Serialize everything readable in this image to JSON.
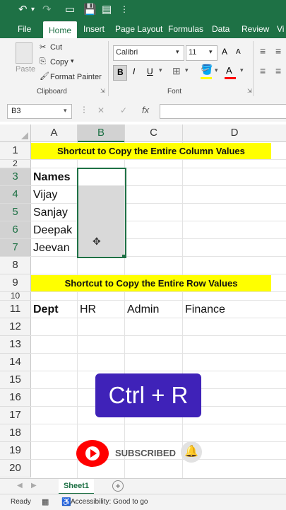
{
  "ribbon_tabs": [
    "File",
    "Home",
    "Insert",
    "Page Layout",
    "Formulas",
    "Data",
    "Review",
    "Vi"
  ],
  "clipboard": {
    "paste": "Paste",
    "cut": "Cut",
    "copy": "Copy",
    "format_painter": "Format Painter",
    "group_label": "Clipboard"
  },
  "font": {
    "name": "Calibri",
    "size": "11",
    "bold": "B",
    "italic": "I",
    "underline": "U",
    "grow": "A",
    "shrink": "A",
    "color_letter": "A",
    "group_label": "Font"
  },
  "name_box": "B3",
  "formula_icons": {
    "fx": "fx",
    "cancel": "✕",
    "enter": "✓"
  },
  "columns": [
    "A",
    "B",
    "C",
    "D"
  ],
  "rows": [
    "1",
    "2",
    "3",
    "4",
    "5",
    "6",
    "7",
    "8",
    "9",
    "10",
    "11",
    "12",
    "13",
    "14",
    "15",
    "16",
    "17",
    "18",
    "19",
    "20"
  ],
  "banner1": "Shortcut to Copy the Entire Column Values",
  "banner2": "Shortcut to Copy the Entire Row Values",
  "names_header": "Names",
  "names": [
    "Vijay",
    "Sanjay",
    "Deepak",
    "Jeevan"
  ],
  "dept_row": {
    "label": "Dept",
    "values": [
      "HR",
      "Admin",
      "Finance"
    ]
  },
  "shortcut": "Ctrl + R",
  "subscribed": "SUBSCRIBED",
  "sheet_tab": "Sheet1",
  "status": {
    "ready": "Ready",
    "accessibility": "Accessibility: Good to go"
  },
  "colors": {
    "excel_green": "#1e7145",
    "banner_yellow": "#ffff00",
    "shortcut_purple": "#3f22b8",
    "youtube_red": "#ff0000",
    "selection": "#d9d9d9"
  }
}
